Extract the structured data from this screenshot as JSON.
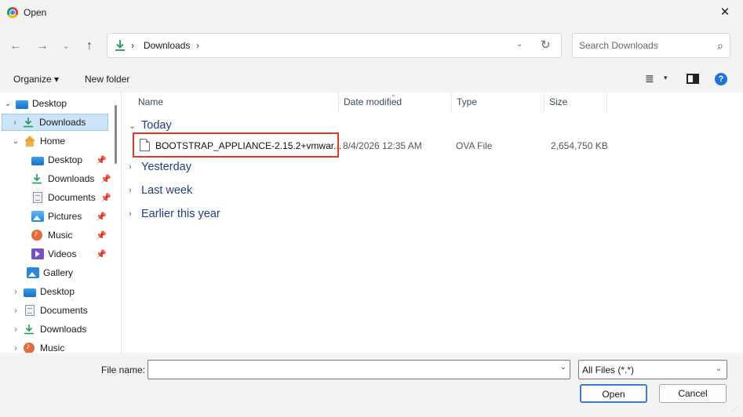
{
  "window": {
    "title": "Open",
    "close_label": "✕"
  },
  "nav": {
    "back": "←",
    "forward": "→",
    "recent": "⌄",
    "up": "↑",
    "breadcrumb_sep": "›",
    "breadcrumb": "Downloads",
    "breadcrumb_sep2": "›",
    "dropdown": "⌄",
    "refresh": "↻",
    "search_placeholder": "Search Downloads",
    "edge_fragment": "⊃"
  },
  "commandbar": {
    "organize": "Organize ▾",
    "new_folder": "New folder",
    "view_menu": "≣",
    "view_drop": "▾",
    "help": "?"
  },
  "sidebar": {
    "items": [
      {
        "label": "Desktop",
        "chevron": "⌄",
        "icon": "desktop-icon"
      },
      {
        "label": "Downloads",
        "chevron": "›",
        "icon": "download-icon"
      },
      {
        "label": "Home",
        "chevron": "⌄",
        "icon": "home-icon"
      },
      {
        "label": "Desktop",
        "icon": "desktop-icon",
        "pinned": true
      },
      {
        "label": "Downloads",
        "icon": "download-icon",
        "pinned": true
      },
      {
        "label": "Documents",
        "icon": "document-icon",
        "pinned": true
      },
      {
        "label": "Pictures",
        "icon": "pictures-icon",
        "pinned": true
      },
      {
        "label": "Music",
        "icon": "music-icon",
        "pinned": true
      },
      {
        "label": "Videos",
        "icon": "videos-icon",
        "pinned": true
      },
      {
        "label": "Gallery",
        "icon": "gallery-icon"
      },
      {
        "label": "Desktop",
        "chevron": "›",
        "icon": "desktop-icon"
      },
      {
        "label": "Documents",
        "chevron": "›",
        "icon": "document-icon"
      },
      {
        "label": "Downloads",
        "chevron": "›",
        "icon": "download-icon"
      },
      {
        "label": "Music",
        "chevron": "›",
        "icon": "music-icon"
      }
    ],
    "pin_glyph": "📌"
  },
  "filelist": {
    "columns": [
      "Name",
      "Date modified",
      "Type",
      "Size"
    ],
    "sort_indicator": "⌄",
    "groups": [
      {
        "label": "Today",
        "chevron": "⌄"
      },
      {
        "label": "Yesterday",
        "chevron": "›"
      },
      {
        "label": "Last week",
        "chevron": "›"
      },
      {
        "label": "Earlier this year",
        "chevron": "›"
      }
    ],
    "files": [
      {
        "name": "BOOTSTRAP_APPLIANCE-2.15.2+vmwar...",
        "date_modified": "8/4/2026 12:35 AM",
        "type": "OVA File",
        "size": "2,654,750 KB"
      }
    ]
  },
  "bottom": {
    "file_name_label": "File name:",
    "file_name_value": "",
    "file_name_drop": "⌄",
    "filter_value": "All Files (*.*)",
    "filter_drop": "⌄",
    "open_button": "Open",
    "cancel_button": "Cancel",
    "grip": "⋰"
  },
  "colors": {
    "accent": "#1e73d8",
    "highlight_border": "#e03b21",
    "selected_bg": "#cce4f7",
    "group_header": "#1e3f8c",
    "download_icon": "#1d9b54"
  }
}
